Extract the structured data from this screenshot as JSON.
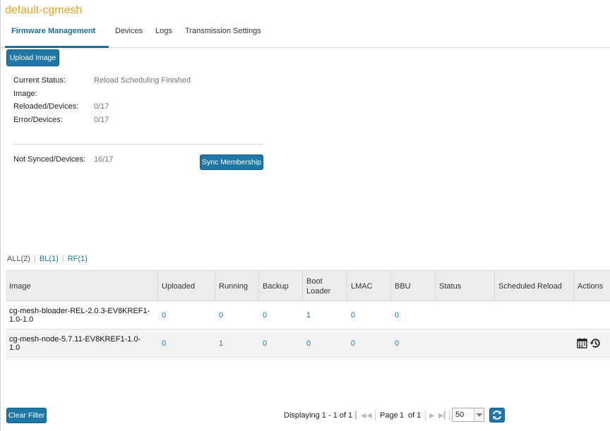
{
  "header": {
    "title": "default-cgmesh"
  },
  "tabs": [
    {
      "label": "Firmware Management",
      "active": true
    },
    {
      "label": "Devices",
      "active": false
    },
    {
      "label": "Logs",
      "active": false
    },
    {
      "label": "Transmission Settings",
      "active": false
    }
  ],
  "toolbar": {
    "upload_label": "Upload Image"
  },
  "status": {
    "current_status_label": "Current Status:",
    "current_status_value": "Reload Scheduling Finished",
    "image_label": "Image:",
    "image_value": "",
    "reloaded_label": "Reloaded/Devices:",
    "reloaded_value": "0/17",
    "error_label": "Error/Devices:",
    "error_value": "0/17",
    "not_synced_label": "Not Synced/Devices:",
    "not_synced_value": "16/17",
    "sync_label": "Sync Membership"
  },
  "filters": {
    "all": "ALL(2)",
    "bl": "BL(1)",
    "rf": "RF(1)",
    "sep": "|"
  },
  "table": {
    "columns": [
      "Image",
      "Uploaded",
      "Running",
      "Backup",
      "Boot Loader",
      "LMAC",
      "BBU",
      "Status",
      "Scheduled Reload",
      "Actions"
    ],
    "rows": [
      {
        "image": "cg-mesh-bloader-REL-2.0.3-EV8KREF1-1.0-1.0",
        "uploaded": "0",
        "running": "0",
        "backup": "0",
        "boot_loader": "1",
        "lmac": "0",
        "bbu": "0",
        "status": "",
        "scheduled_reload": ""
      },
      {
        "image": "cg-mesh-node-5.7.11-EV8KREF1-1.0-1.0",
        "uploaded": "0",
        "running": "1",
        "backup": "0",
        "boot_loader": "0",
        "lmac": "0",
        "bbu": "0",
        "status": "",
        "scheduled_reload": "",
        "actions": [
          "calendar-icon",
          "history-icon"
        ]
      }
    ]
  },
  "footer": {
    "clear_filter_label": "Clear Filter",
    "displaying": "Displaying 1 - 1 of 1",
    "page_label": "Page",
    "page_value": "1",
    "of_label": "of 1",
    "page_size": "50"
  },
  "colors": {
    "accent": "#1f77a8",
    "title": "#f0a01e",
    "link": "#1f77a8"
  }
}
